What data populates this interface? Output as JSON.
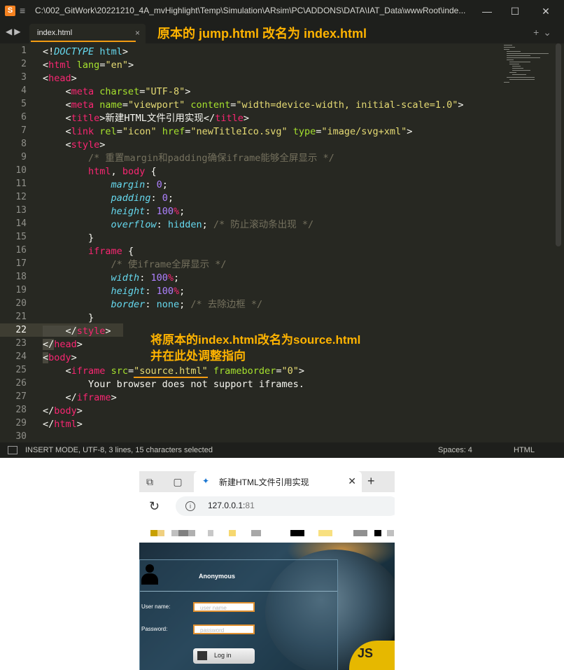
{
  "window": {
    "title": "C:\\002_GitWork\\20221210_4A_mvHighlight\\Temp\\Simulation\\ARsim\\PC\\ADDONS\\DATA\\IAT_Data\\wwwRoot\\inde...",
    "minimize": "—",
    "maximize": "☐",
    "close": "✕"
  },
  "tab": {
    "label": "index.html",
    "close": "×"
  },
  "annotations": {
    "top": "原本的 jump.html 改名为 index.html",
    "mid_line1": "将原本的index.html改名为source.html",
    "mid_line2": "并在此处调整指向"
  },
  "editor": {
    "current_line": 22,
    "line_numbers": [
      "1",
      "2",
      "3",
      "4",
      "5",
      "6",
      "7",
      "8",
      "9",
      "10",
      "11",
      "12",
      "13",
      "14",
      "15",
      "16",
      "17",
      "18",
      "19",
      "20",
      "21",
      "22",
      "23",
      "24",
      "25",
      "26",
      "27",
      "28",
      "29",
      "30"
    ],
    "lines": [
      [
        [
          "pn",
          "<!"
        ],
        [
          "kw",
          "DOCTYPE"
        ],
        [
          "pn",
          " "
        ],
        [
          "val",
          "html"
        ],
        [
          "pn",
          ">"
        ]
      ],
      [
        [
          "pn",
          "<"
        ],
        [
          "tag",
          "html"
        ],
        [
          "pn",
          " "
        ],
        [
          "attr",
          "lang"
        ],
        [
          "pn",
          "="
        ],
        [
          "str",
          "\"en\""
        ],
        [
          "pn",
          ">"
        ]
      ],
      [
        [
          "pn",
          "<"
        ],
        [
          "tag",
          "head"
        ],
        [
          "pn",
          ">"
        ]
      ],
      [
        [
          "pn",
          "    <"
        ],
        [
          "tag",
          "meta"
        ],
        [
          "pn",
          " "
        ],
        [
          "attr",
          "charset"
        ],
        [
          "pn",
          "="
        ],
        [
          "str",
          "\"UTF-8\""
        ],
        [
          "pn",
          ">"
        ]
      ],
      [
        [
          "pn",
          "    <"
        ],
        [
          "tag",
          "meta"
        ],
        [
          "pn",
          " "
        ],
        [
          "attr",
          "name"
        ],
        [
          "pn",
          "="
        ],
        [
          "str",
          "\"viewport\""
        ],
        [
          "pn",
          " "
        ],
        [
          "attr",
          "content"
        ],
        [
          "pn",
          "="
        ],
        [
          "str",
          "\"width=device-width, initial-scale=1.0\""
        ],
        [
          "pn",
          ">"
        ]
      ],
      [
        [
          "pn",
          "    <"
        ],
        [
          "tag",
          "title"
        ],
        [
          "pn",
          ">新建HTML文件引用实现</"
        ],
        [
          "tag",
          "title"
        ],
        [
          "pn",
          ">"
        ]
      ],
      [
        [
          "pn",
          "    <"
        ],
        [
          "tag",
          "link"
        ],
        [
          "pn",
          " "
        ],
        [
          "attr",
          "rel"
        ],
        [
          "pn",
          "="
        ],
        [
          "str",
          "\"icon\""
        ],
        [
          "pn",
          " "
        ],
        [
          "attr",
          "href"
        ],
        [
          "pn",
          "="
        ],
        [
          "str",
          "\"newTitleIco.svg\""
        ],
        [
          "pn",
          " "
        ],
        [
          "attr",
          "type"
        ],
        [
          "pn",
          "="
        ],
        [
          "str",
          "\"image/svg+xml\""
        ],
        [
          "pn",
          ">"
        ]
      ],
      [
        [
          "pn",
          "    <"
        ],
        [
          "tag",
          "style"
        ],
        [
          "pn",
          ">"
        ]
      ],
      [
        [
          "cmt",
          "        /* 重置margin和padding确保iframe能够全屏显示 */"
        ]
      ],
      [
        [
          "pn",
          "        "
        ],
        [
          "sel",
          "html"
        ],
        [
          "pn",
          ", "
        ],
        [
          "sel",
          "body"
        ],
        [
          "pn",
          " {"
        ]
      ],
      [
        [
          "pn",
          "            "
        ],
        [
          "prop",
          "margin"
        ],
        [
          "pn",
          ": "
        ],
        [
          "num",
          "0"
        ],
        [
          "pn",
          ";"
        ]
      ],
      [
        [
          "pn",
          "            "
        ],
        [
          "prop",
          "padding"
        ],
        [
          "pn",
          ": "
        ],
        [
          "num",
          "0"
        ],
        [
          "pn",
          ";"
        ]
      ],
      [
        [
          "pn",
          "            "
        ],
        [
          "prop",
          "height"
        ],
        [
          "pn",
          ": "
        ],
        [
          "num",
          "100"
        ],
        [
          "sel",
          "%"
        ],
        [
          "pn",
          ";"
        ]
      ],
      [
        [
          "pn",
          "            "
        ],
        [
          "prop",
          "overflow"
        ],
        [
          "pn",
          ": "
        ],
        [
          "val",
          "hidden"
        ],
        [
          "pn",
          "; "
        ],
        [
          "cmt",
          "/* 防止滚动条出现 */"
        ]
      ],
      [
        [
          "pn",
          "        }"
        ]
      ],
      [
        [
          "pn",
          "        "
        ],
        [
          "sel",
          "iframe"
        ],
        [
          "pn",
          " {"
        ]
      ],
      [
        [
          "cmt",
          "            /* 使iframe全屏显示 */"
        ]
      ],
      [
        [
          "pn",
          "            "
        ],
        [
          "prop",
          "width"
        ],
        [
          "pn",
          ": "
        ],
        [
          "num",
          "100"
        ],
        [
          "sel",
          "%"
        ],
        [
          "pn",
          ";"
        ]
      ],
      [
        [
          "pn",
          "            "
        ],
        [
          "prop",
          "height"
        ],
        [
          "pn",
          ": "
        ],
        [
          "num",
          "100"
        ],
        [
          "sel",
          "%"
        ],
        [
          "pn",
          ";"
        ]
      ],
      [
        [
          "pn",
          "            "
        ],
        [
          "prop",
          "border"
        ],
        [
          "pn",
          ": "
        ],
        [
          "val",
          "none"
        ],
        [
          "pn",
          "; "
        ],
        [
          "cmt",
          "/* 去除边框 */"
        ]
      ],
      [
        [
          "pn",
          "        }"
        ]
      ],
      [
        [
          "pn",
          "    </"
        ],
        [
          "tag",
          "style"
        ],
        [
          "pn",
          ">"
        ]
      ],
      [
        [
          "pn",
          "</"
        ],
        [
          "tag",
          "head"
        ],
        [
          "pn",
          ">"
        ]
      ],
      [
        [
          "pn",
          "<"
        ],
        [
          "tag",
          "body"
        ],
        [
          "pn",
          ">"
        ]
      ],
      [
        [
          "pn",
          "    <"
        ],
        [
          "tag",
          "iframe"
        ],
        [
          "pn",
          " "
        ],
        [
          "attr",
          "src"
        ],
        [
          "pn",
          "="
        ],
        [
          "str",
          "\"source.html\""
        ],
        [
          "pn",
          " "
        ],
        [
          "attr",
          "frameborder"
        ],
        [
          "pn",
          "="
        ],
        [
          "str",
          "\"0\""
        ],
        [
          "pn",
          ">"
        ]
      ],
      [
        [
          "pn",
          "        Your browser does not support iframes."
        ]
      ],
      [
        [
          "pn",
          "    </"
        ],
        [
          "tag",
          "iframe"
        ],
        [
          "pn",
          ">"
        ]
      ],
      [
        [
          "pn",
          "</"
        ],
        [
          "tag",
          "body"
        ],
        [
          "pn",
          ">"
        ]
      ],
      [
        [
          "pn",
          "</"
        ],
        [
          "tag",
          "html"
        ],
        [
          "pn",
          ">"
        ]
      ],
      [
        [
          "pn",
          ""
        ]
      ]
    ]
  },
  "status": {
    "mode": "INSERT MODE, UTF-8, 3 lines, 15 characters selected",
    "spaces": "Spaces: 4",
    "syntax": "HTML"
  },
  "browser": {
    "tab_title": "新建HTML文件引用实现",
    "tab_close": "✕",
    "new_tab": "+",
    "url_host": "127.0.0.1:",
    "url_port": "81",
    "page": {
      "user_label": "Anonymous",
      "username_label": "User name:",
      "username_placeholder": "user name",
      "password_label": "Password:",
      "password_placeholder": "password",
      "login_button": "Log in",
      "logo_text": "JS"
    }
  },
  "colors": {
    "accent": "#f39c12",
    "annotation": "#ffb300",
    "editor_bg": "#272822"
  }
}
